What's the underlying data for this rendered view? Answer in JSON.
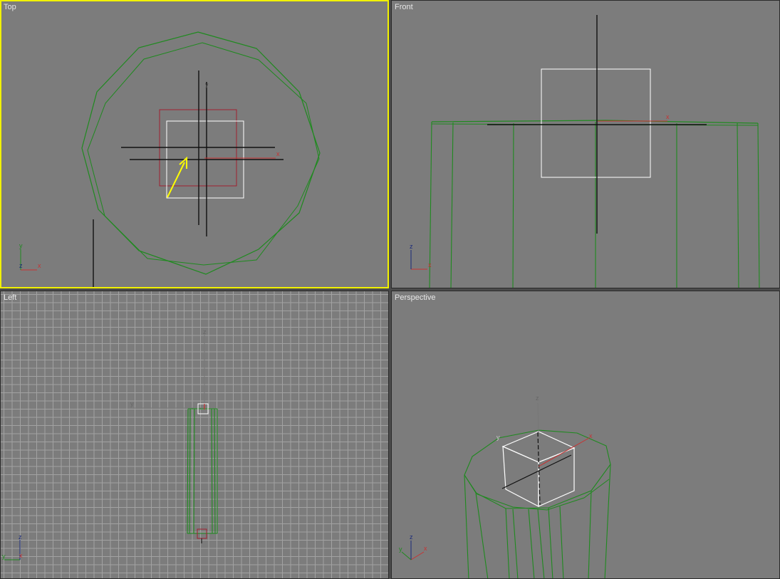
{
  "viewports": {
    "top": {
      "label": "Top",
      "active": true
    },
    "front": {
      "label": "Front",
      "active": false
    },
    "left": {
      "label": "Left",
      "active": false
    },
    "perspective": {
      "label": "Perspective",
      "active": false
    }
  },
  "axis_labels": {
    "x": "x",
    "y": "y",
    "z": "z"
  },
  "colors": {
    "viewport_bg": "#7c7c7c",
    "active_border": "#f2f200",
    "geometry": "#1f8a1f",
    "selection_box": "#ffffff",
    "gizmo_x": "#c83232",
    "gizmo_black": "#111111",
    "pivot_box": "#a02030",
    "annotation_arrow": "#ffff00",
    "grid_line": "#a2a2a2"
  },
  "icons": {
    "axis_tripod": "axis-tripod-icon",
    "annotation": "yellow-arrow-annotation"
  }
}
